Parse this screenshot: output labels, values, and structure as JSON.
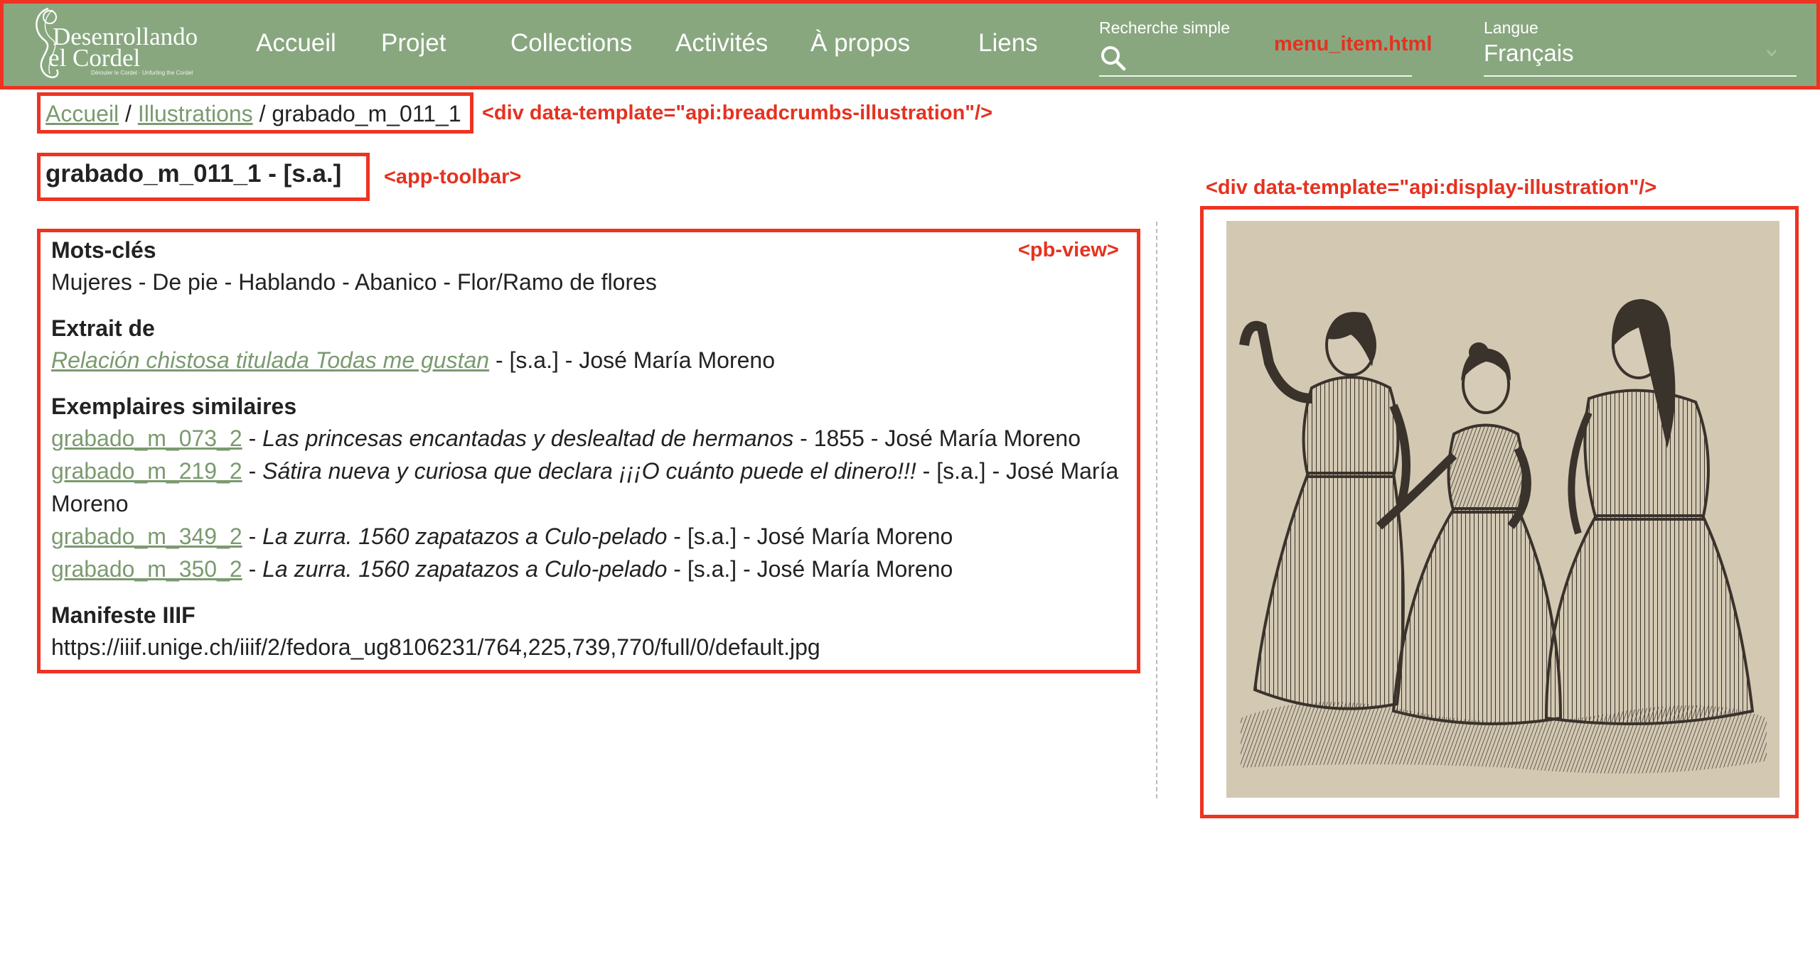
{
  "header": {
    "logo": {
      "line1": "Desenrollando",
      "line2": "el Cordel",
      "subtitle": "Dérouler le Cordel · Unfurling the Cordel"
    },
    "nav_items": [
      {
        "label": "Accueil"
      },
      {
        "label": "Projet"
      },
      {
        "label": "Collections"
      },
      {
        "label": "Activités"
      },
      {
        "label": "À propos"
      },
      {
        "label": "Liens"
      }
    ],
    "search": {
      "label": "Recherche simple",
      "placeholder": "",
      "icon": "search-icon"
    },
    "language": {
      "label": "Langue",
      "selected": "Français",
      "icon": "chevron-down-icon"
    },
    "colors": {
      "background": "#88a77f",
      "text": "#ffffff"
    }
  },
  "annotations": {
    "menu": "menu_item.html",
    "breadcrumbs": "<div data-template=\"api:breadcrumbs-illustration\"/>",
    "toolbar": "<app-toolbar>",
    "view": "<pb-view>",
    "display": "<div data-template=\"api:display-illustration\"/>",
    "color": "#ee3322"
  },
  "breadcrumb": {
    "items": [
      "Accueil",
      "Illustrations",
      "grabado_m_011_1"
    ],
    "separator": "/"
  },
  "page_title": "grabado_m_011_1 - [s.a.]",
  "metadata": {
    "keywords": {
      "heading": "Mots-clés",
      "value": "Mujeres - De pie - Hablando - Abanico - Flor/Ramo de flores"
    },
    "excerpt": {
      "heading": "Extrait de",
      "link": "Relación chistosa titulada Todas me gustan",
      "rest": " - [s.a.] - José María Moreno"
    },
    "similar": {
      "heading": "Exemplaires similaires",
      "items": [
        {
          "id": "grabado_m_073_2",
          "title": "Las princesas encantadas y deslealtad de hermanos",
          "rest": " - 1855 - José María Moreno"
        },
        {
          "id": "grabado_m_219_2",
          "title": "Sátira nueva y curiosa que declara ¡¡¡O cuánto puede el dinero!!!",
          "rest": " - [s.a.] - José María Moreno"
        },
        {
          "id": "grabado_m_349_2",
          "title": "La zurra. 1560 zapatazos a Culo-pelado",
          "rest": " - [s.a.] - José María Moreno"
        },
        {
          "id": "grabado_m_350_2",
          "title": "La zurra. 1560 zapatazos a Culo-pelado",
          "rest": " - [s.a.] - José María Moreno"
        }
      ]
    },
    "manifest": {
      "heading": "Manifeste IIIF",
      "value": "https://iiif.unige.ch/iiif/2/fedora_ug8106231/764,225,739,770/full/0/default.jpg"
    }
  },
  "illustration": {
    "colors": {
      "paper": "#d6cbb6",
      "ink": "#3a332c"
    }
  }
}
